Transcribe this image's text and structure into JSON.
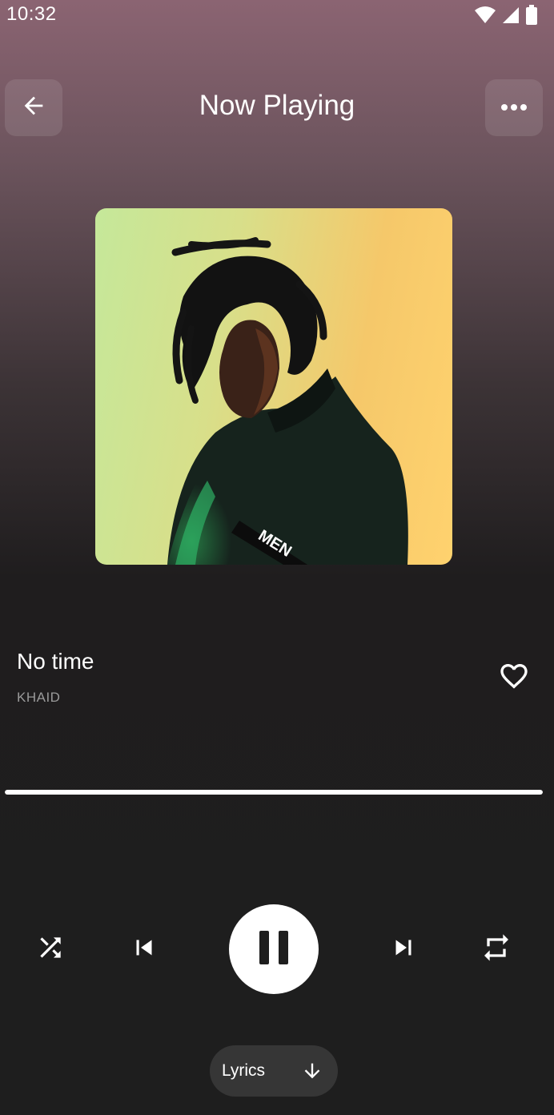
{
  "status_bar": {
    "time": "10:32",
    "icons": [
      "wifi-icon",
      "cellular-signal-icon",
      "battery-icon"
    ]
  },
  "header": {
    "title": "Now Playing",
    "back_icon": "arrow-left-icon",
    "more_icon": "more-horizontal-icon"
  },
  "album": {
    "art_text": "MEN"
  },
  "track": {
    "title": "No time",
    "artist": "KHAID",
    "liked": false
  },
  "progress": {
    "fraction": 1.0
  },
  "controls": {
    "shuffle_icon": "shuffle-icon",
    "previous_icon": "skip-previous-icon",
    "play_state": "playing",
    "pause_icon": "pause-icon",
    "next_icon": "skip-next-icon",
    "repeat_icon": "repeat-icon"
  },
  "lyrics": {
    "label": "Lyrics",
    "icon": "arrow-down-icon"
  },
  "colors": {
    "gradient_top": "#8b6472",
    "background": "#1e1e1e",
    "accent": "#ffffff",
    "muted_text": "#9a9a9a",
    "pill_background": "#363636"
  }
}
